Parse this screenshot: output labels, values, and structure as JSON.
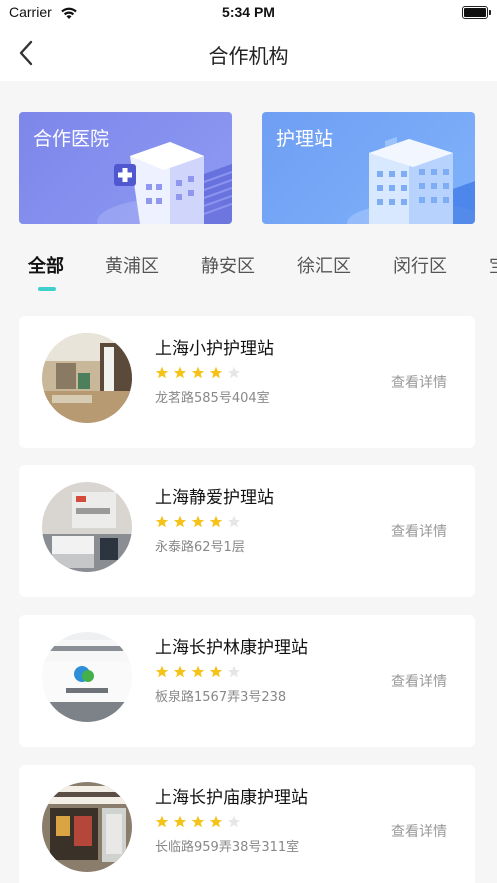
{
  "status_bar": {
    "carrier": "Carrier",
    "time": "5:34 PM"
  },
  "nav": {
    "title": "合作机构"
  },
  "banners": [
    {
      "label": "合作医院"
    },
    {
      "label": "护理站"
    }
  ],
  "tabs": [
    "全部",
    "黄浦区",
    "静安区",
    "徐汇区",
    "闵行区",
    "宝山区"
  ],
  "active_tab": "全部",
  "accent_color": "#3fcfcc",
  "star_color": "#f5c218",
  "stations": [
    {
      "name": "上海小护护理站",
      "rating": 4,
      "address": "龙茗路585号404室",
      "action": "查看详情"
    },
    {
      "name": "上海静爱护理站",
      "rating": 4,
      "address": "永泰路62号1层",
      "action": "查看详情"
    },
    {
      "name": "上海长护林康护理站",
      "rating": 4,
      "address": "板泉路1567弄3号238",
      "action": "查看详情"
    },
    {
      "name": "上海长护庙康护理站",
      "rating": 4,
      "address": "长临路959弄38号311室",
      "action": "查看详情"
    }
  ]
}
